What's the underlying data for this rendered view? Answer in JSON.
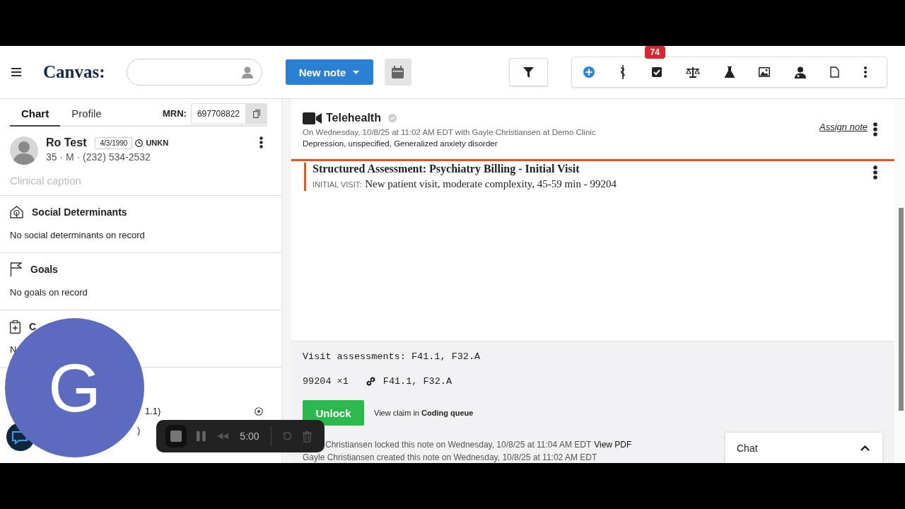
{
  "header": {
    "logo": "Canvas:",
    "new_note": "New note",
    "notification_count": "74"
  },
  "tabs": [
    {
      "label": "Chart",
      "selected": true
    },
    {
      "label": "Profile",
      "selected": false
    }
  ],
  "mrn": {
    "label": "MRN:",
    "value": "697708822"
  },
  "patient": {
    "name": "Ro Test",
    "dob": "4/3/1990",
    "timezone": "UNKN",
    "details": "35 · M · (232) 534-2532",
    "caption_placeholder": "Clinical caption"
  },
  "sections": [
    {
      "kind": "house",
      "title": "Social Determinants",
      "text": "No social determinants on record"
    },
    {
      "kind": "flag",
      "title": "Goals",
      "text": "No goals on record"
    },
    {
      "kind": "clipboard",
      "title": "C",
      "text": "N"
    }
  ],
  "partial_items": [
    "1.1)",
    ")"
  ],
  "note": {
    "type": "Telehealth",
    "meta": "On Wednesday, 10/8/25 at 11:02 AM EDT with Gayle Christiansen at Demo Clinic",
    "diagnoses": "Depression, unspecified, Generalized anxiety disorder",
    "assign": "Assign note",
    "command": {
      "title": "Structured Assessment:  Psychiatry Billing - Initial Visit",
      "label": "INITIAL VISIT:",
      "value": "New patient visit, moderate complexity, 45-59 min - 99204"
    }
  },
  "billing": {
    "assessments": "Visit assessments: F41.1, F32.A",
    "code": "99204 ×1",
    "linked": "F41.1, F32.A",
    "unlock": "Unlock",
    "claim": "View claim in **Coding queue**",
    "locked": "Christiansen locked this note on Wednesday, 10/8/25 at 11:04 AM EDT",
    "view_pdf": "View PDF",
    "created": "Gayle Christiansen created this note on Wednesday, 10/8/25 at 11:02 AM EDT"
  },
  "chat": {
    "label": "Chat"
  },
  "recorder": {
    "time": "5:00"
  },
  "avatar": {
    "initial": "G"
  }
}
